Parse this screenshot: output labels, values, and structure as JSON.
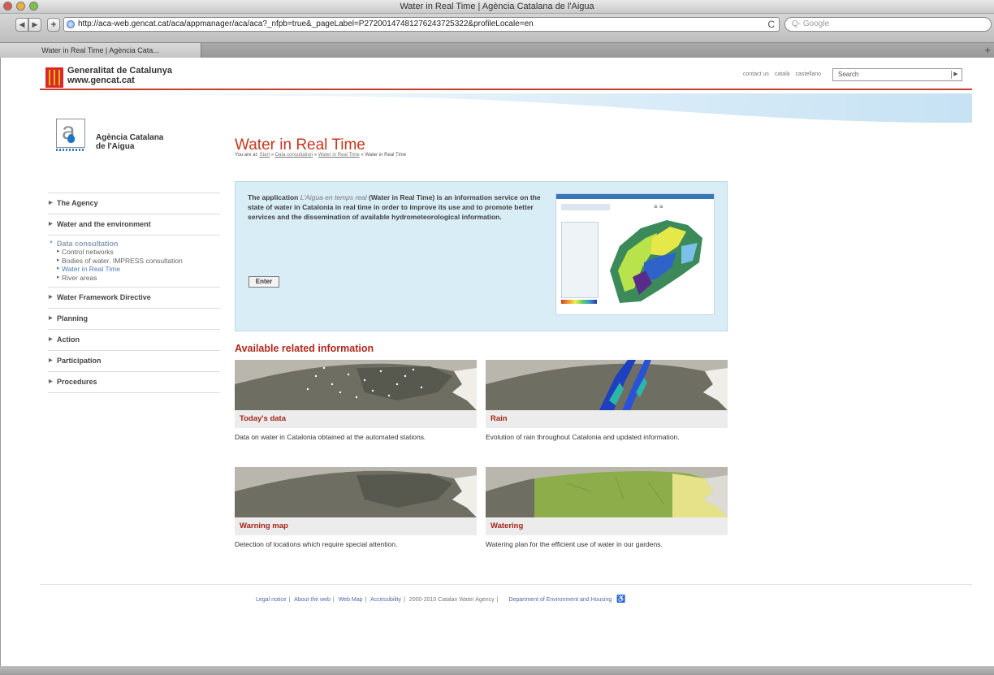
{
  "window": {
    "title": "Water in Real Time | Agència Catalana de l'Aigua"
  },
  "toolbar": {
    "url": "http://aca-web.gencat.cat/aca/appmanager/aca/aca?_nfpb=true&_pageLabel=P27200147481276243725322&profileLocale=en",
    "search_placeholder": "Q- Google",
    "add_label": "+",
    "reload_label": "C"
  },
  "tabs": [
    {
      "label": "Water in Real Time | Agència Cata..."
    }
  ],
  "header": {
    "gen_line1": "Generalitat de Catalunya",
    "gen_line2": "www.gencat.cat",
    "links": [
      "contact us",
      "català",
      "castellano"
    ],
    "search_value": "Search"
  },
  "agency": {
    "name_line1": "Agència Catalana",
    "name_line2": "de l'Aigua"
  },
  "main": {
    "title": "Water in Real Time",
    "breadcrumb_prefix": "You are at:",
    "breadcrumb": [
      "Start",
      "Data consultation",
      "Water in Real Time",
      "Water in Real Time"
    ],
    "intro_before": "The application ",
    "intro_app": "L'Aigua en temps real",
    "intro_after": " (Water in Real Time) is an information service on the state of water in Catalonia in real time in order to improve its use and to promote better services and the dissemination of available hydrometeorological information.",
    "enter_label": "Enter",
    "related_heading": "Available related information"
  },
  "sidebar": {
    "items_before": [
      "The Agency",
      "Water and the environment"
    ],
    "open_item": "Data consultation",
    "sub_items": [
      "Control networks",
      "Bodies of water. IMPRESS consultation",
      "Water in Real Time",
      "River areas"
    ],
    "active_sub": 2,
    "items_after": [
      "Water Framework Directive",
      "Planning",
      "Action",
      "Participation",
      "Procedures"
    ]
  },
  "cards": [
    {
      "title": "Today's data",
      "desc": "Data on water in Catalonia obtained at the automated stations."
    },
    {
      "title": "Rain",
      "desc": "Evolution of rain throughout Catalonia and updated information."
    },
    {
      "title": "Warning map",
      "desc": "Detection of locations which require special attention."
    },
    {
      "title": "Watering",
      "desc": "Watering plan for the efficient use of water in our gardens."
    }
  ],
  "footer": {
    "links": [
      "Legal notice",
      "About the web",
      "Web Map",
      "Accessibility",
      "2000-2010 Catalan Water Agency",
      "Department of Environment and Housing"
    ],
    "accessibility_icon": "wheelchair-icon"
  },
  "colors": {
    "accent_red": "#c8361f",
    "intro_bg": "#d9edf7",
    "link_blue": "#4a7dbc"
  }
}
